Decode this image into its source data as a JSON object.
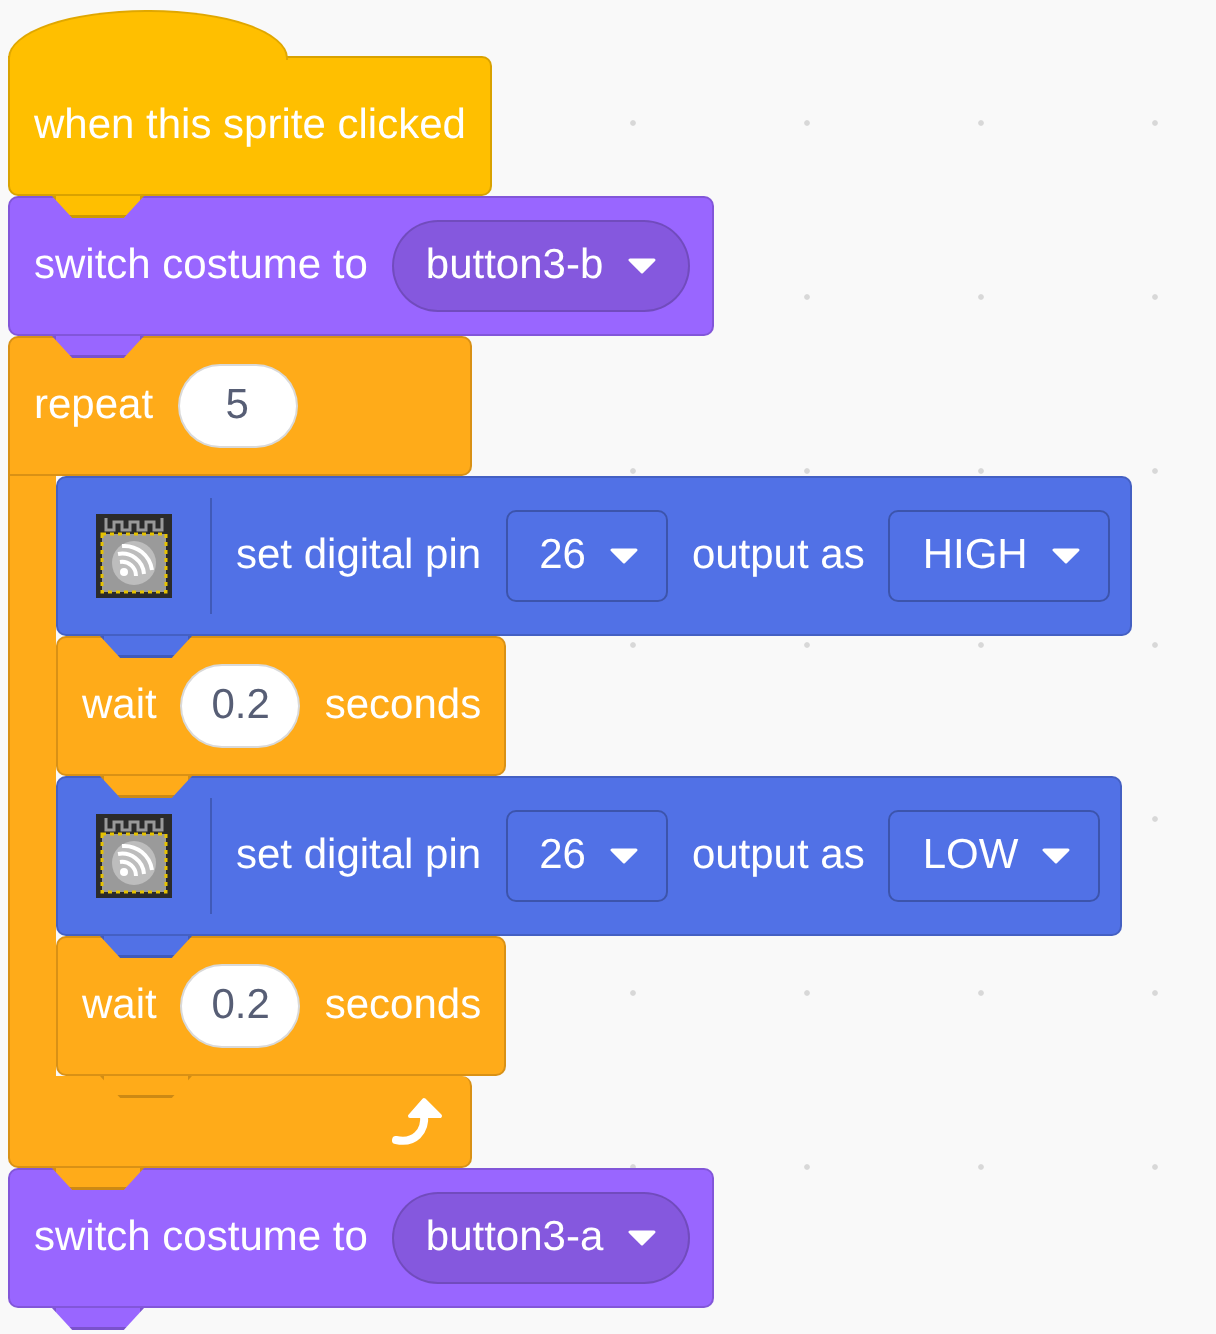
{
  "blocks": [
    {
      "kind": "hat",
      "color": "#ffbf00",
      "parts": [
        {
          "kind": "text",
          "text": "when this sprite clicked"
        }
      ]
    },
    {
      "kind": "stack",
      "color": "#9966ff",
      "parts": [
        {
          "kind": "text",
          "text": "switch costume to"
        },
        {
          "kind": "menu",
          "text": "button3-b"
        }
      ]
    },
    {
      "kind": "c",
      "color": "#ffab19",
      "parts": [
        {
          "kind": "text",
          "text": "repeat"
        },
        {
          "kind": "number",
          "text": "5"
        }
      ],
      "children": [
        {
          "kind": "extension",
          "color": "#5171e6",
          "parts": [
            {
              "kind": "text",
              "text": "set digital pin"
            },
            {
              "kind": "dropdown",
              "text": "26"
            },
            {
              "kind": "text",
              "text": "output as"
            },
            {
              "kind": "dropdown",
              "text": "HIGH"
            }
          ]
        },
        {
          "kind": "stack",
          "color": "#ffab19",
          "parts": [
            {
              "kind": "text",
              "text": "wait"
            },
            {
              "kind": "number",
              "text": "0.2"
            },
            {
              "kind": "text",
              "text": "seconds"
            }
          ]
        },
        {
          "kind": "extension",
          "color": "#5171e6",
          "parts": [
            {
              "kind": "text",
              "text": "set digital pin"
            },
            {
              "kind": "dropdown",
              "text": "26"
            },
            {
              "kind": "text",
              "text": "output as"
            },
            {
              "kind": "dropdown",
              "text": "LOW"
            }
          ]
        },
        {
          "kind": "stack",
          "color": "#ffab19",
          "parts": [
            {
              "kind": "text",
              "text": "wait"
            },
            {
              "kind": "number",
              "text": "0.2"
            },
            {
              "kind": "text",
              "text": "seconds"
            }
          ]
        }
      ]
    },
    {
      "kind": "stack",
      "color": "#9966ff",
      "parts": [
        {
          "kind": "text",
          "text": "switch costume to"
        },
        {
          "kind": "menu",
          "text": "button3-a"
        }
      ]
    }
  ]
}
